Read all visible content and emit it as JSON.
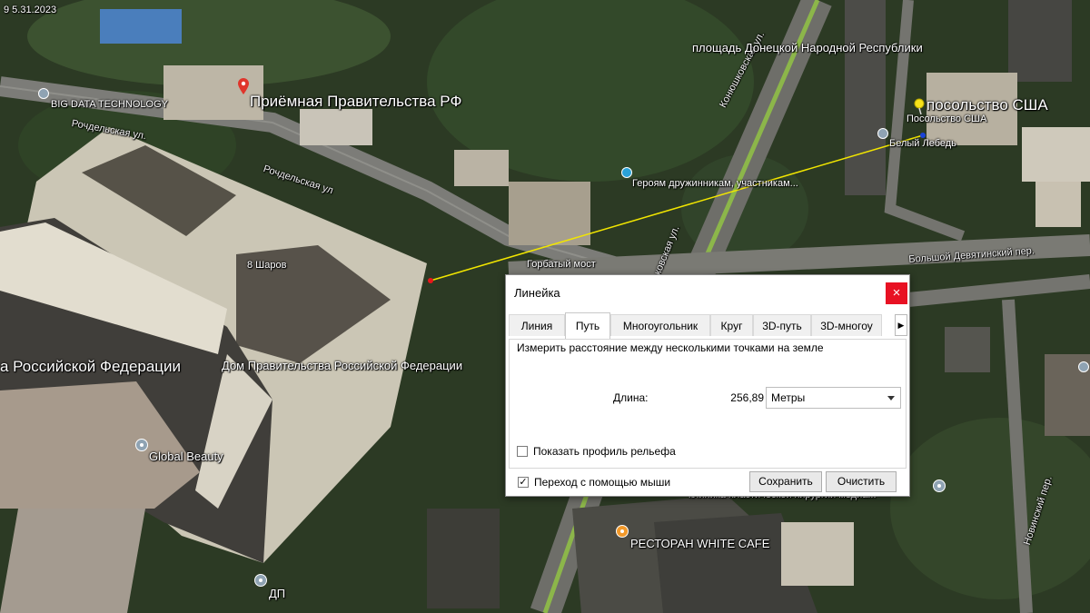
{
  "map": {
    "date_stamp": "9 5.31.2023",
    "labels": {
      "reception": "Приёмная Правительства РФ",
      "big_data": "BIG DATA TECHNOLOGY",
      "rochdelskaya_1": "Рочдельская ул.",
      "rochdelskaya_2": "Рочдельская ул",
      "sharov": "8 Шаров",
      "federation": "а Российской Федерации",
      "dom_pravitelstva": "Дом Правительства Российской Федерации",
      "global_beauty": "Global Beauty",
      "dp": "ДП",
      "gorbaty_most": "Горбатый мост",
      "geroyam": "Героям дружинникам, участникам...",
      "ploshchad": "площадь Донецкой Народной Республики",
      "embassy_big": "посольство США",
      "embassy_small": "Посольство США",
      "bely_lebed": "Белый Лебедь",
      "konyushkovskaya": "Конюшковская ул.",
      "konyushkovskaya_2": "ковская ул.",
      "devyatinsky": "Большой Девятинский пер.",
      "novinsky": "Новинский пер.",
      "klinika": "клиника пластической хирургии медиа...",
      "restoran": "РЕСТОРАН WHITE CAFE"
    },
    "ruler_line_color": "#f2e600"
  },
  "ruler": {
    "title": "Линейка",
    "close_label": "×",
    "tabs": [
      "Линия",
      "Путь",
      "Многоугольник",
      "Круг",
      "3D-путь",
      "3D-многоу"
    ],
    "active_tab": "Путь",
    "description": "Измерить расстояние между несколькими точками на земле",
    "length_label": "Длина:",
    "length_value": "256,89",
    "units_selected": "Метры",
    "show_profile_label": "Показать профиль рельефа",
    "show_profile_checked": false,
    "mouse_nav_label": "Переход с помощью мыши",
    "mouse_nav_checked": true,
    "mouse_nav_mark": "✓",
    "save_label": "Сохранить",
    "clear_label": "Очистить"
  }
}
